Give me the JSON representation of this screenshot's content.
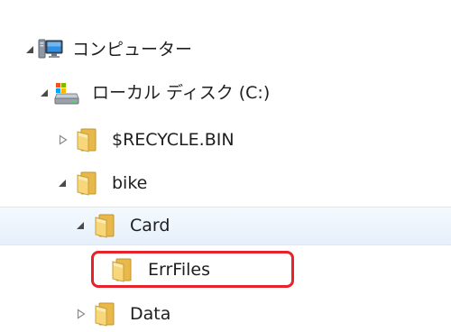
{
  "tree": {
    "computer": {
      "label": "コンピューター",
      "icon": "computer-icon",
      "expanded": true
    },
    "local_disk": {
      "label": "ローカル ディスク (C:)",
      "icon": "drive-icon",
      "expanded": true
    },
    "recycle_bin": {
      "label": "$RECYCLE.BIN",
      "icon": "folder-icon",
      "expanded": false
    },
    "bike": {
      "label": "bike",
      "icon": "folder-icon",
      "expanded": true
    },
    "card": {
      "label": "Card",
      "icon": "folder-icon",
      "expanded": true,
      "selected": true
    },
    "err_files": {
      "label": "ErrFiles",
      "icon": "folder-icon",
      "highlighted": true
    },
    "data": {
      "label": "Data",
      "icon": "folder-icon",
      "expanded": false
    }
  },
  "colors": {
    "highlight_border": "#e8222a",
    "selection_background": "#e6f0fb",
    "folder_yellow": "#f1c95b"
  }
}
